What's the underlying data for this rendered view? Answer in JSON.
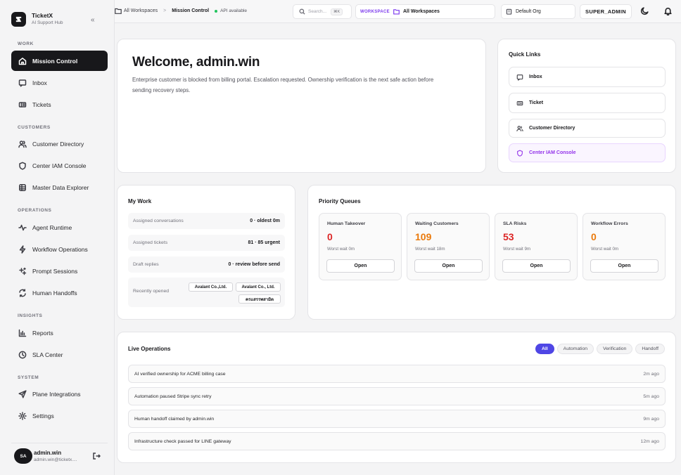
{
  "brand": {
    "name": "TicketX",
    "subtitle": "AI Support Hub",
    "collapse": "«"
  },
  "sidebar": {
    "sections": [
      "WORK",
      "CUSTOMERS",
      "OPERATIONS",
      "INSIGHTS",
      "SYSTEM"
    ],
    "items": [
      {
        "label": "Mission Control",
        "icon": "home-icon"
      },
      {
        "label": "Inbox",
        "icon": "inbox-icon"
      },
      {
        "label": "Tickets",
        "icon": "ticket-icon"
      },
      {
        "label": "Customer Directory",
        "icon": "users-icon"
      },
      {
        "label": "Center IAM Console",
        "icon": "shield-icon"
      },
      {
        "label": "Master Data Explorer",
        "icon": "database-icon"
      },
      {
        "label": "Agent Runtime",
        "icon": "pulse-icon"
      },
      {
        "label": "Workflow Operations",
        "icon": "workflow-icon"
      },
      {
        "label": "Prompt Sessions",
        "icon": "sparkle-icon"
      },
      {
        "label": "Human Handoffs",
        "icon": "handoff-icon"
      },
      {
        "label": "Reports",
        "icon": "bar-chart-icon"
      },
      {
        "label": "SLA Center",
        "icon": "clock-icon"
      },
      {
        "label": "Plane Integrations",
        "icon": "send-icon"
      },
      {
        "label": "Settings",
        "icon": "gear-icon"
      }
    ],
    "user": {
      "initials": "SA",
      "name": "admin.win",
      "email": "admin.win@ticketx...."
    }
  },
  "topbar": {
    "breadcrumb_root": "All Workspaces",
    "breadcrumb_sep": ">",
    "breadcrumb_current": "Mission Control",
    "api_status": "API available",
    "api_color": "#22c55e",
    "search_placeholder": "Search...",
    "search_kbd": "⌘K",
    "workspace_label": "WORKSPACE",
    "workspace_value": "All Workspaces",
    "org": "Default Org",
    "role": "SUPER_ADMIN"
  },
  "welcome": {
    "title": "Welcome, admin.win",
    "description": "Enterprise customer is blocked from billing portal. Escalation requested. Ownership verification is the next safe action before sending recovery steps."
  },
  "quick_links": {
    "title": "Quick Links",
    "items": [
      {
        "label": "Inbox",
        "icon": "inbox-icon"
      },
      {
        "label": "Ticket",
        "icon": "ticket-icon"
      },
      {
        "label": "Customer Directory",
        "icon": "users-icon"
      },
      {
        "label": "Center IAM Console",
        "icon": "shield-icon"
      }
    ]
  },
  "my_work": {
    "title": "My Work",
    "rows": [
      {
        "label": "Assigned conversations",
        "value": "0 · oldest 0m"
      },
      {
        "label": "Assigned tickets",
        "value": "81 · 85 urgent"
      },
      {
        "label": "Draft replies",
        "value": "0 · review before send"
      }
    ],
    "recent_label": "Recently opened",
    "recent": [
      "Avalant Co.,Ltd.",
      "Avalant Co., Ltd.",
      "ครแสรรพสามิต"
    ]
  },
  "priority_queues": {
    "title": "Priority Queues",
    "items": [
      {
        "title": "Human Takeover",
        "value": "0",
        "color": "#dc2626",
        "wait": "Worst wait 0m",
        "button": "Open"
      },
      {
        "title": "Waiting Customers",
        "value": "109",
        "color": "#ea7a0c",
        "wait": "Worst wait 18m",
        "button": "Open"
      },
      {
        "title": "SLA Risks",
        "value": "53",
        "color": "#dc2626",
        "wait": "Worst wait 9m",
        "button": "Open"
      },
      {
        "title": "Workflow Errors",
        "value": "0",
        "color": "#ea7a0c",
        "wait": "Worst wait 0m",
        "button": "Open"
      }
    ]
  },
  "live_operations": {
    "title": "Live Operations",
    "tabs": [
      "All",
      "Automation",
      "Verification",
      "Handoff"
    ],
    "active_tab": "All",
    "events": [
      {
        "text": "AI verified ownership for ACME billing case",
        "time": "2m ago"
      },
      {
        "text": "Automation paused Stripe sync retry",
        "time": "5m ago"
      },
      {
        "text": "Human handoff claimed by admin.win",
        "time": "9m ago"
      },
      {
        "text": "Infrastructure check passed for LINE gateway",
        "time": "12m ago"
      }
    ]
  }
}
